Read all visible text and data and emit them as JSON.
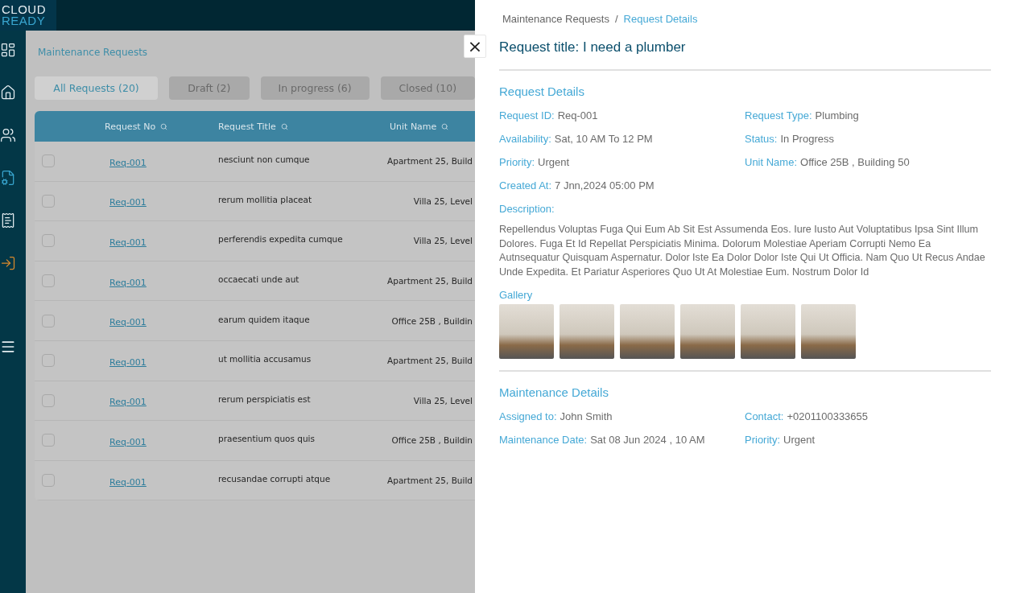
{
  "logo": {
    "line_1": "CLOUD",
    "line_2": "READY"
  },
  "sidebar": {
    "items": [
      {
        "selected": false
      },
      {
        "selected": false
      },
      {
        "selected": false
      },
      {
        "selected": true
      },
      {
        "selected": false
      },
      {
        "selected": false
      }
    ]
  },
  "page": {
    "title": "Maintenance Requests",
    "tabs": [
      {
        "label": "All Requests (20)",
        "selected": true
      },
      {
        "label": "Draft (2)",
        "selected": false
      },
      {
        "label": "In progress (6)",
        "selected": false
      },
      {
        "label": "Closed (10)",
        "selected": false
      }
    ],
    "table": {
      "columns": [
        "Request No",
        "Request Title",
        "Unit Name"
      ],
      "rows": [
        {
          "checked": false,
          "request_no": "Req-001",
          "title": "nesciunt non cumque",
          "unit": "Apartment 25, Build"
        },
        {
          "checked": false,
          "request_no": "Req-001",
          "title": "rerum mollitia placeat",
          "unit": "Villa 25, Level"
        },
        {
          "checked": false,
          "request_no": "Req-001",
          "title": "perferendis expedita cumque",
          "unit": "Villa 25, Level"
        },
        {
          "checked": false,
          "request_no": "Req-001",
          "title": "occaecati unde aut",
          "unit": "Apartment 25, Build"
        },
        {
          "checked": false,
          "request_no": "Req-001",
          "title": "earum quidem itaque",
          "unit": "Office 25B , Buildin"
        },
        {
          "checked": false,
          "request_no": "Req-001",
          "title": "ut mollitia accusamus",
          "unit": "Apartment 25, Build"
        },
        {
          "checked": false,
          "request_no": "Req-001",
          "title": "rerum perspiciatis est",
          "unit": "Villa 25, Level"
        },
        {
          "checked": false,
          "request_no": "Req-001",
          "title": "praesentium quos quis",
          "unit": "Office 25B , Buildin"
        },
        {
          "checked": false,
          "request_no": "Req-001",
          "title": "recusandae corrupti atque",
          "unit": "Apartment 25, Build"
        }
      ]
    }
  },
  "drawer": {
    "close": "×",
    "breadcrumb": [
      {
        "label": "Maintenance Requests",
        "selected": false
      },
      {
        "label": "Request Details",
        "selected": true
      }
    ],
    "separator": "/",
    "title": "Request title: I need a plumber",
    "request_section": {
      "heading": "Request Details",
      "fields": [
        {
          "label": "Request ID:",
          "value": "Req-001"
        },
        {
          "label": "Request Type:",
          "value": "Plumbing"
        },
        {
          "label": "Availability:",
          "value": "Sat, 10 AM To 12 PM"
        },
        {
          "label": "Status:",
          "value": "In Progress"
        },
        {
          "label": "Priority:",
          "value": "Urgent"
        },
        {
          "label": "Unit Name:",
          "value": "Office 25B , Building 50"
        },
        {
          "label": "Created At:",
          "value": "7 Jnn,2024 05:00 PM"
        }
      ],
      "description_label": "Description:",
      "description": "Repellendus Voluptas Fuga Qui Eum Ab Sit Est Assumenda Eos. Iure Iusto Aut Voluptatibus Ipsa Sint Illum Dolores. Fuga Et Id Repellat Perspiciatis Minima. Dolorum Molestiae Aperiam Corrupti Nemo Ea Autnsequatur Quisquam Aspernatur. Dolor Iste Ea Dolor Dolor Iste Qui Ut Officia. Nam Quo Ut Recus Andae Unde Expedita. Et Pariatur Asperiores Quo Ut At Molestiae Eum. Nostrum Dolor Id",
      "gallery_label": "Gallery"
    },
    "maintenance_section": {
      "heading": "Maintenance Details",
      "fields": [
        {
          "label": "Assigned to:",
          "value": "John Smith"
        },
        {
          "label": "Contact:",
          "value": "+0201100333655"
        },
        {
          "label": "Maintenance Date:",
          "value": "Sat 08 Jun 2024 , 10 AM"
        },
        {
          "label": "Priority:",
          "value": "Urgent"
        }
      ]
    }
  }
}
